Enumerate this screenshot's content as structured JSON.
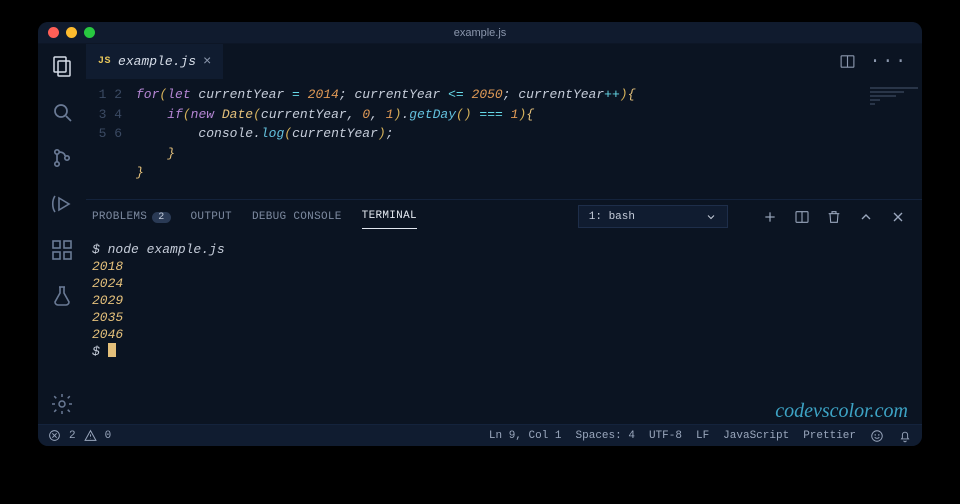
{
  "titlebar": {
    "title": "example.js"
  },
  "tab": {
    "lang_badge": "JS",
    "filename": "example.js"
  },
  "code": {
    "lines": [
      "1",
      "2",
      "3",
      "4",
      "5",
      "6"
    ],
    "l1_for": "for",
    "l1_paren_o": "(",
    "l1_let": "let",
    "l1_var": " currentYear ",
    "l1_eq": "= ",
    "l1_2014": "2014",
    "l1_semi1": "; ",
    "l1_var2": "currentYear ",
    "l1_le": "<= ",
    "l1_2050": "2050",
    "l1_semi2": "; ",
    "l1_var3": "currentYear",
    "l1_inc": "++",
    "l1_paren_c": ")",
    "l1_brace": "{",
    "l2_if": "if",
    "l2_po": "(",
    "l2_new": "new ",
    "l2_date": "Date",
    "l2_args_o": "(",
    "l2_cy": "currentYear",
    "l2_c1": ", ",
    "l2_z": "0",
    "l2_c2": ", ",
    "l2_one": "1",
    "l2_args_c": ")",
    "l2_dot": ".",
    "l2_getday": "getDay",
    "l2_gc": "()",
    "l2_eee": " === ",
    "l2_oneb": "1",
    "l2_pc": ")",
    "l2_br": "{",
    "l3_console": "console",
    "l3_dot": ".",
    "l3_log": "log",
    "l3_po": "(",
    "l3_cy": "currentYear",
    "l3_pc": ")",
    "l3_semi": ";",
    "l4_brace": "}",
    "l5_brace": "}"
  },
  "panel": {
    "problems": "PROBLEMS",
    "problems_count": "2",
    "output": "OUTPUT",
    "debug": "DEBUG CONSOLE",
    "terminal": "TERMINAL",
    "term_selected": "1: bash"
  },
  "terminal": {
    "cmd_prompt": "$ ",
    "cmd": "node example.js",
    "out": [
      "2018",
      "2024",
      "2029",
      "2035",
      "2046"
    ],
    "prompt2": "$ "
  },
  "status": {
    "errors": "2",
    "warnings": "0",
    "cursor": "Ln 9, Col 1",
    "spaces": "Spaces: 4",
    "encoding": "UTF-8",
    "eol": "LF",
    "lang": "JavaScript",
    "formatter": "Prettier"
  },
  "watermark": "codevscolor.com"
}
